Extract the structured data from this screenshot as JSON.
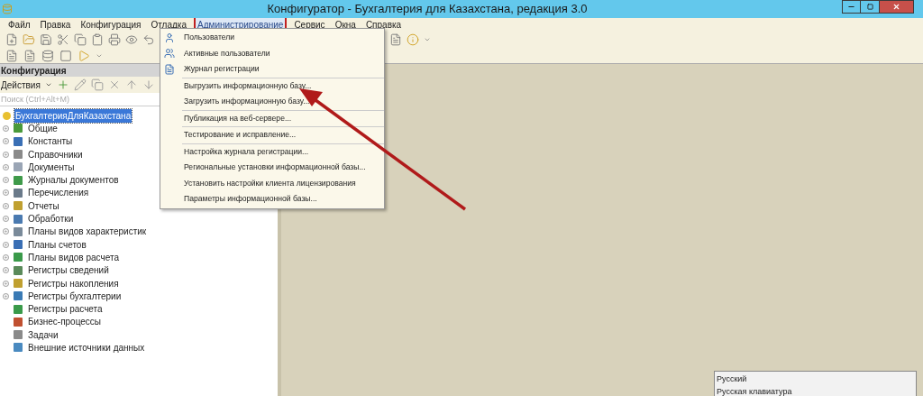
{
  "window": {
    "title": "Конфигуратор - Бухгалтерия для Казахстана, редакция 3.0"
  },
  "menu_bar": [
    {
      "label": "Файл",
      "selected": false
    },
    {
      "label": "Правка",
      "selected": false
    },
    {
      "label": "Конфигурация",
      "selected": false
    },
    {
      "label": "Отладка",
      "selected": false
    },
    {
      "label": "Администрирование",
      "selected": true
    },
    {
      "label": "Сервис",
      "selected": false
    },
    {
      "label": "Окна",
      "selected": false
    },
    {
      "label": "Справка",
      "selected": false
    }
  ],
  "dropdown": {
    "groups": [
      [
        {
          "label": "Пользователи"
        },
        {
          "label": "Активные пользователи"
        },
        {
          "label": "Журнал регистрации"
        }
      ],
      [
        {
          "label": "Выгрузить информационную базу..."
        },
        {
          "label": "Загрузить информационную базу..."
        }
      ],
      [
        {
          "label": "Публикация на веб-сервере..."
        }
      ],
      [
        {
          "label": "Тестирование и исправление..."
        }
      ],
      [
        {
          "label": "Настройка журнала регистрации..."
        },
        {
          "label": "Региональные установки информационной базы..."
        },
        {
          "label": "Установить настройки клиента лицензирования"
        },
        {
          "label": "Параметры информационной базы..."
        }
      ]
    ]
  },
  "panel": {
    "title": "Конфигурация",
    "actions_label": "Действия",
    "search": {
      "placeholder": "Поиск (Ctrl+Alt+M)"
    },
    "tree": {
      "label": "БухгалтерияДляКазахстана",
      "selected": true,
      "children": [
        {
          "label": "Общие",
          "expandable": true
        },
        {
          "label": "Константы",
          "expandable": true
        },
        {
          "label": "Справочники",
          "expandable": true
        },
        {
          "label": "Документы",
          "expandable": true
        },
        {
          "label": "Журналы документов",
          "expandable": true
        },
        {
          "label": "Перечисления",
          "expandable": true
        },
        {
          "label": "Отчеты",
          "expandable": true
        },
        {
          "label": "Обработки",
          "expandable": true
        },
        {
          "label": "Планы видов характеристик",
          "expandable": true
        },
        {
          "label": "Планы счетов",
          "expandable": true
        },
        {
          "label": "Планы видов расчета",
          "expandable": true
        },
        {
          "label": "Регистры сведений",
          "expandable": true
        },
        {
          "label": "Регистры накопления",
          "expandable": true
        },
        {
          "label": "Регистры бухгалтерии",
          "expandable": true
        },
        {
          "label": "Регистры расчета",
          "expandable": false
        },
        {
          "label": "Бизнес-процессы",
          "expandable": false
        },
        {
          "label": "Задачи",
          "expandable": false
        },
        {
          "label": "Внешние источники данных",
          "expandable": false
        }
      ]
    }
  },
  "language_popup": [
    "Русский",
    "Русская клавиатура"
  ]
}
